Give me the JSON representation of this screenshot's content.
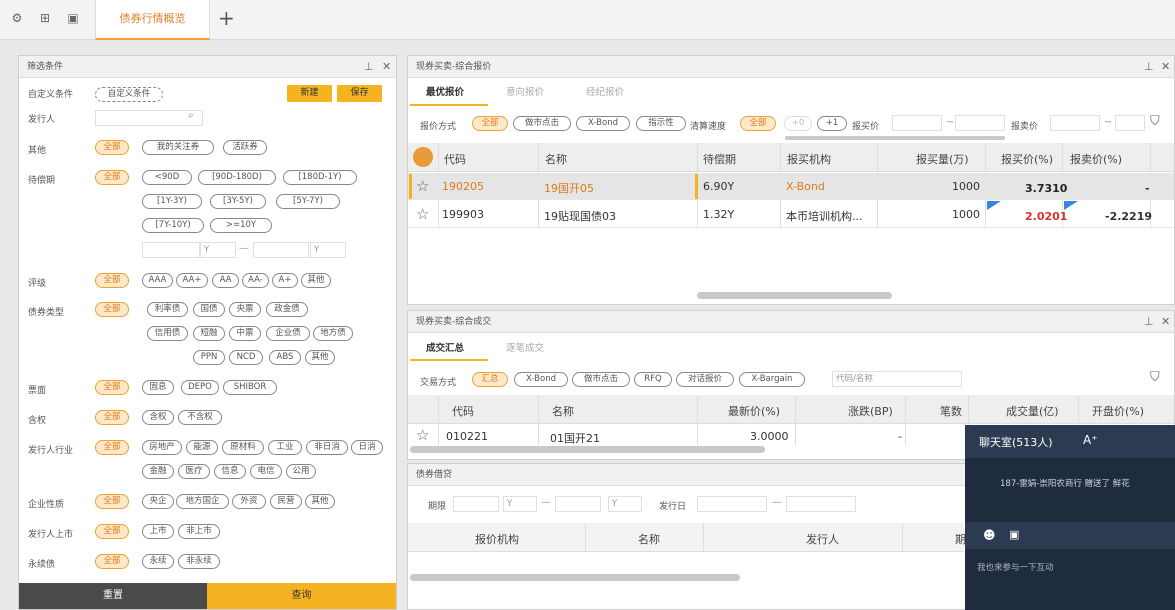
{
  "tabs": {
    "active": "债券行情概览",
    "add": "+"
  },
  "icons": {
    "top": [
      "gear-icon",
      "grid-icon",
      "window-icon"
    ]
  },
  "filter": {
    "title": "筛选条件",
    "custom_label": "自定义条件",
    "custom_value": "自定义条件",
    "new_btn": "新建",
    "save_btn": "保存",
    "issuer_label": "发行人",
    "other_label": "其他",
    "other_opts": [
      "全部",
      "我的关注券",
      "活跃券"
    ],
    "term_label": "待偿期",
    "term_opts": [
      "全部",
      "<90D",
      "[90D-180D)",
      "[180D-1Y)",
      "[1Y-3Y)",
      "[3Y-5Y)",
      "[5Y-7Y)",
      "[7Y-10Y)",
      ">=10Y"
    ],
    "unit1": "Y",
    "unit2": "Y",
    "dash": "—",
    "rating_label": "评级",
    "rating_opts": [
      "全部",
      "AAA",
      "AA+",
      "AA",
      "AA-",
      "A+",
      "其他"
    ],
    "btype_label": "债券类型",
    "btype_opts": [
      "全部",
      "利率债",
      "国债",
      "央票",
      "政金债",
      "信用债",
      "短融",
      "中票",
      "企业债",
      "地方债",
      "PPN",
      "NCD",
      "ABS",
      "其他"
    ],
    "coupon_label": "票面",
    "coupon_opts": [
      "全部",
      "固息",
      "DEPO",
      "SHIBOR"
    ],
    "option_label": "含权",
    "option_opts": [
      "全部",
      "含权",
      "不含权"
    ],
    "ind_label": "发行人行业",
    "ind_opts": [
      "全部",
      "房地产",
      "能源",
      "原材料",
      "工业",
      "非日消",
      "日消",
      "金融",
      "医疗",
      "信息",
      "电信",
      "公用"
    ],
    "ent_label": "企业性质",
    "ent_opts": [
      "全部",
      "央企",
      "地方国企",
      "外资",
      "民营",
      "其他"
    ],
    "listed_label": "发行人上市",
    "listed_opts": [
      "全部",
      "上市",
      "非上市"
    ],
    "perp_label": "永续债",
    "perp_opts": [
      "全部",
      "永续",
      "非永续"
    ],
    "reset": "重置",
    "query": "查询"
  },
  "quote": {
    "title": "现券买卖-综合报价",
    "subtabs": [
      "最优报价",
      "意向报价",
      "经纪报价"
    ],
    "mode_label": "报价方式",
    "mode_opts": [
      "全部",
      "做市点击",
      "X-Bond",
      "指示性"
    ],
    "speed_label": "清算速度",
    "speed_opts": [
      "全部",
      "+0",
      "+1"
    ],
    "bid_label": "报买价",
    "ask_label": "报卖价",
    "tilde": "~",
    "headers": [
      "代码",
      "名称",
      "待偿期",
      "报买机构",
      "报买量(万)",
      "报买价(%)",
      "报卖价(%)"
    ],
    "rows": [
      {
        "code": "190205",
        "name": "19国开05",
        "term": "6.90Y",
        "org": "X-Bond",
        "vol": "1000",
        "bid": "3.7310",
        "ask": "-"
      },
      {
        "code": "199903",
        "name": "19贴现国债03",
        "term": "1.32Y",
        "org": "本币培训机构...",
        "vol": "1000",
        "bid": "2.0201",
        "ask": "-2.2219"
      }
    ]
  },
  "trade": {
    "title": "现券买卖-综合成交",
    "subtabs": [
      "成交汇总",
      "逐笔成交"
    ],
    "mode_label": "交易方式",
    "mode_opts": [
      "汇总",
      "X-Bond",
      "做市点击",
      "RFQ",
      "对话报价",
      "X-Bargain"
    ],
    "search_ph": "代码/名称",
    "headers": [
      "代码",
      "名称",
      "最新价(%)",
      "涨跌(BP)",
      "笔数",
      "成交量(亿)",
      "开盘价(%)"
    ],
    "rows": [
      {
        "code": "010221",
        "name": "01国开21",
        "price": "3.0000",
        "chg": "-"
      }
    ]
  },
  "lend": {
    "title": "债券借贷",
    "term_label": "期限",
    "issue_label": "发行日",
    "unit1": "Y",
    "unit2": "Y",
    "dash": "—",
    "headers": [
      "报价机构",
      "名称",
      "发行人",
      "期"
    ]
  },
  "chat": {
    "title": "聊天室(513人)",
    "font_btn": "A⁺",
    "message": "187-雷娟-崇阳农商行 赠送了 鲜花",
    "placeholder": "我也来参与一下互动"
  },
  "colors": {
    "accent": "#f5b321",
    "orange_text": "#e07a1a",
    "red": "#d9342b",
    "chat_bg": "#1f2c3d"
  }
}
